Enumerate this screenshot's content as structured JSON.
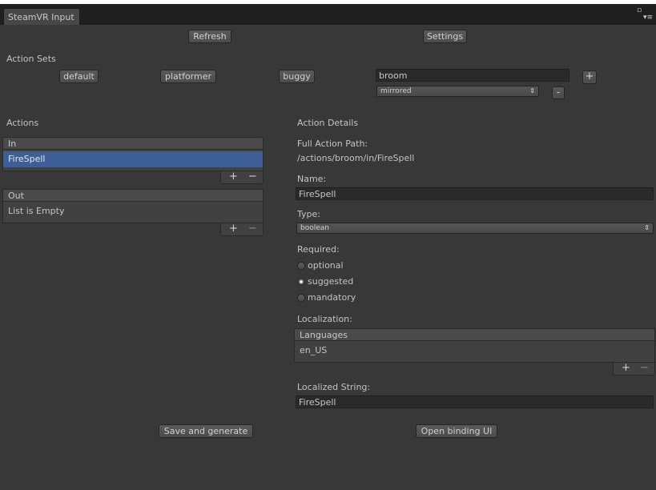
{
  "window": {
    "tab_title": "SteamVR Input",
    "controls": {
      "maximize": "▫",
      "menu": "▾≡"
    }
  },
  "toolbar": {
    "refresh_label": "Refresh",
    "settings_label": "Settings"
  },
  "action_sets": {
    "heading": "Action Sets",
    "items": [
      "default",
      "platformer",
      "buggy"
    ],
    "name_value": "broom",
    "usage_value": "mirrored",
    "add_label": "+",
    "remove_label": "-"
  },
  "actions": {
    "heading": "Actions",
    "in_list": {
      "header": "In",
      "items": [
        "FireSpell"
      ],
      "add": "+",
      "remove": "−"
    },
    "out_list": {
      "header": "Out",
      "empty_text": "List is Empty",
      "add": "+",
      "remove": "−"
    }
  },
  "details": {
    "heading": "Action Details",
    "full_path_label": "Full Action Path:",
    "full_path_value": "/actions/broom/in/FireSpell",
    "name_label": "Name:",
    "name_value": "FireSpell",
    "type_label": "Type:",
    "type_value": "boolean",
    "required_label": "Required:",
    "required_options": [
      "optional",
      "suggested",
      "mandatory"
    ],
    "required_selected": "suggested",
    "localization_label": "Localization:",
    "languages_header": "Languages",
    "languages": [
      "en_US"
    ],
    "lang_add": "+",
    "lang_remove": "−",
    "localized_label": "Localized String:",
    "localized_value": "FireSpell"
  },
  "bottom": {
    "save_label": "Save and generate",
    "open_binding_label": "Open binding UI"
  }
}
